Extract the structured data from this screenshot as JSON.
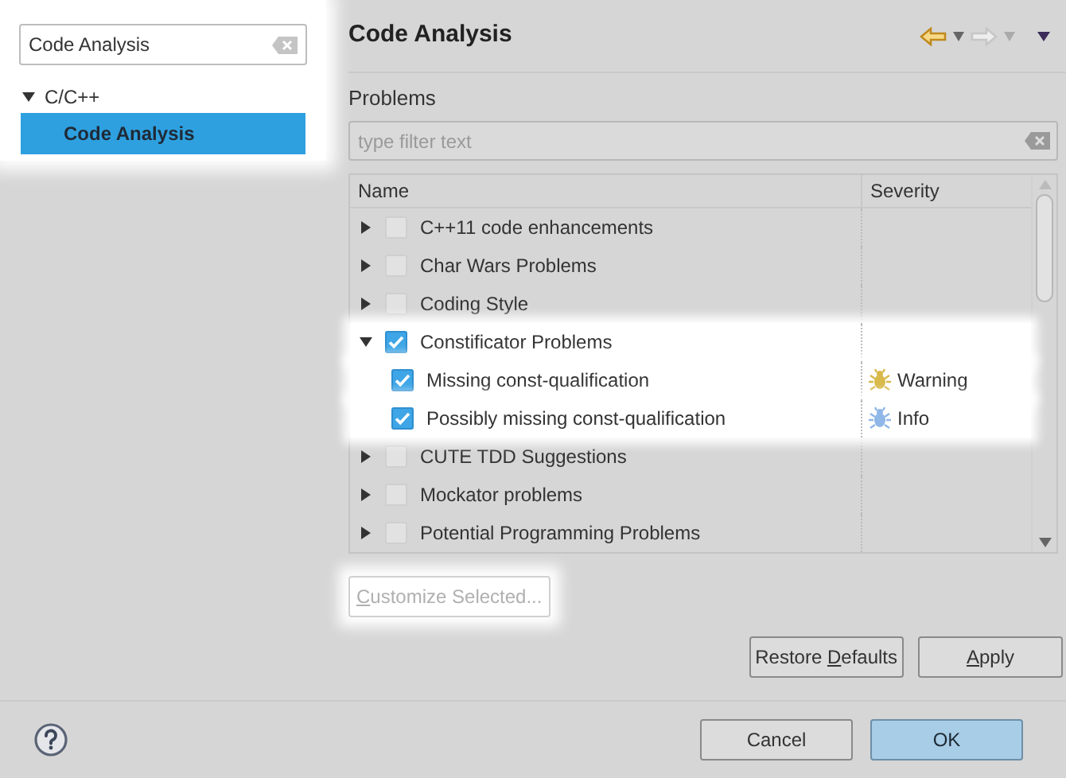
{
  "sidebar": {
    "highlighted": true,
    "search": {
      "value": "Code Analysis"
    },
    "tree": [
      {
        "label": "C/C++",
        "expanded": true,
        "selected": false,
        "children": [
          {
            "label": "Code Analysis",
            "selected": true
          }
        ]
      }
    ]
  },
  "page": {
    "title": "Code Analysis",
    "section_label": "Problems",
    "filter": {
      "placeholder": "type filter text"
    },
    "table": {
      "columns": [
        "Name",
        "Severity"
      ],
      "rows": [
        {
          "label": "C++11 code enhancements",
          "expanded": false,
          "checked": false,
          "highlighted": false
        },
        {
          "label": "Char Wars Problems",
          "expanded": false,
          "checked": false,
          "highlighted": false
        },
        {
          "label": "Coding Style",
          "expanded": false,
          "checked": false,
          "highlighted": false
        },
        {
          "label": "Constificator Problems",
          "expanded": true,
          "checked": true,
          "highlighted": true,
          "children": [
            {
              "label": "Missing const-qualification",
              "checked": true,
              "severity": "Warning",
              "color": "#d8b94a"
            },
            {
              "label": "Possibly missing const-qualification",
              "checked": true,
              "severity": "Info",
              "color": "#8fb7e8"
            }
          ]
        },
        {
          "label": "CUTE TDD Suggestions",
          "expanded": false,
          "checked": false,
          "highlighted": false
        },
        {
          "label": "Mockator problems",
          "expanded": false,
          "checked": false,
          "highlighted": false
        },
        {
          "label": "Potential Programming Problems",
          "expanded": false,
          "checked": false,
          "highlighted": false
        }
      ]
    },
    "customize_button": {
      "parts": [
        {
          "text": "C",
          "underlined": true
        },
        {
          "text": "ustomize Selected...",
          "underlined": false
        }
      ],
      "disabled": true,
      "highlighted": true
    },
    "page_buttons": [
      {
        "parts": [
          {
            "text": "Restore ",
            "underlined": false
          },
          {
            "text": "D",
            "underlined": true
          },
          {
            "text": "efaults",
            "underlined": false
          }
        ],
        "default": false
      },
      {
        "parts": [
          {
            "text": "A",
            "underlined": true
          },
          {
            "text": "pply",
            "underlined": false
          }
        ],
        "default": false
      }
    ]
  },
  "dialog_buttons": [
    {
      "parts": [
        {
          "text": "Cancel",
          "underlined": false
        }
      ],
      "default": false
    },
    {
      "parts": [
        {
          "text": "OK",
          "underlined": false
        }
      ],
      "default": true
    }
  ]
}
